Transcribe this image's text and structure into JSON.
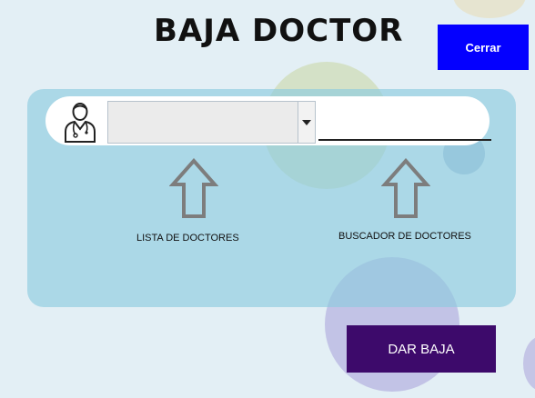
{
  "title": "BAJA DOCTOR",
  "close_button": "Cerrar",
  "doctor_combo": {
    "selected": ""
  },
  "doctor_search": {
    "value": ""
  },
  "labels": {
    "doctor_list": "LISTA DE DOCTORES",
    "doctor_search": "BUSCADOR DE DOCTORES"
  },
  "submit_button": "DAR BAJA",
  "colors": {
    "close_button_bg": "#0400ff",
    "submit_button_bg": "#3d0a6b",
    "panel_bg": "#8ecbde",
    "page_bg": "#e3eff5"
  },
  "icons": [
    "doctor-icon",
    "chevron-down-icon",
    "arrow-up-icon"
  ]
}
